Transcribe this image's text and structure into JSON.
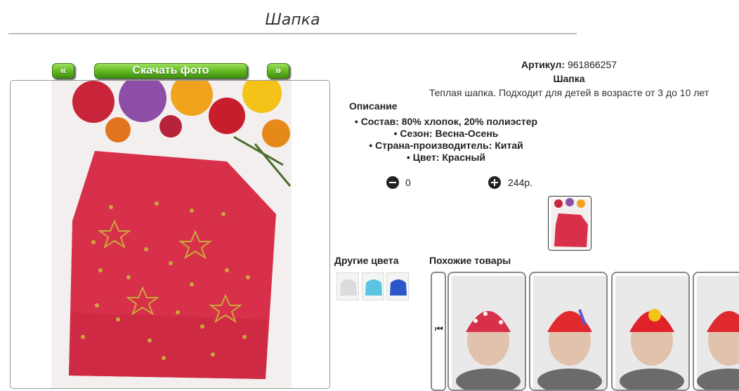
{
  "page": {
    "title": "Шапка"
  },
  "gallery": {
    "prev_label": "«",
    "download_label": "Скачать фото",
    "next_label": "»"
  },
  "product": {
    "article_label": "Артикул:",
    "article_value": "961866257",
    "name": "Шапка",
    "description": "Теплая шапка. Подходит для детей в возрасте от 3 до 10 лет",
    "description_heading": "Описание",
    "bullets": [
      "Состав: 80% хлопок, 20% полиэстер",
      "Сезон: Весна-Осень",
      "Страна-производитель: Китай",
      "Цвет: Красный"
    ],
    "quantity": "0",
    "price": "244р."
  },
  "other_colors": {
    "title": "Другие цвета",
    "swatches": [
      "#dcdcdc",
      "#5bc4e0",
      "#2a56c9"
    ]
  },
  "similar": {
    "title": "Похожие товары",
    "prev_icon": "⏮"
  },
  "colors": {
    "accent_green": "#5fb61f",
    "hat_red": "#d8304a"
  }
}
